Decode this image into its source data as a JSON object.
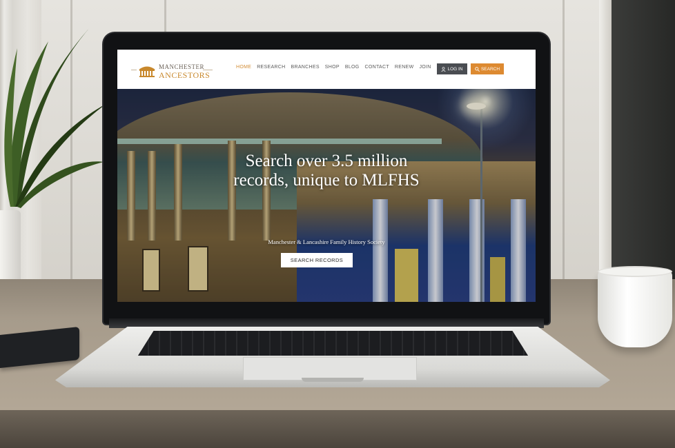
{
  "site": {
    "logo": {
      "line1": "MANCHESTER",
      "line2": "ANCESTORS"
    },
    "nav": [
      "HOME",
      "RESEARCH",
      "BRANCHES",
      "SHOP",
      "BLOG",
      "CONTACT",
      "RENEW",
      "JOIN"
    ],
    "active_nav": "HOME",
    "login_label": "LOG IN",
    "search_label": "SEARCH",
    "hero": {
      "title_line1": "Search over 3.5 million",
      "title_line2": "records, unique to MLFHS",
      "subtitle": "Manchester & Lancashire Family History Society",
      "button_label": "SEARCH RECORDS"
    },
    "colors": {
      "accent": "#dd8a31",
      "login_bg": "#4a4d52",
      "header_bg": "#ffffff"
    }
  }
}
